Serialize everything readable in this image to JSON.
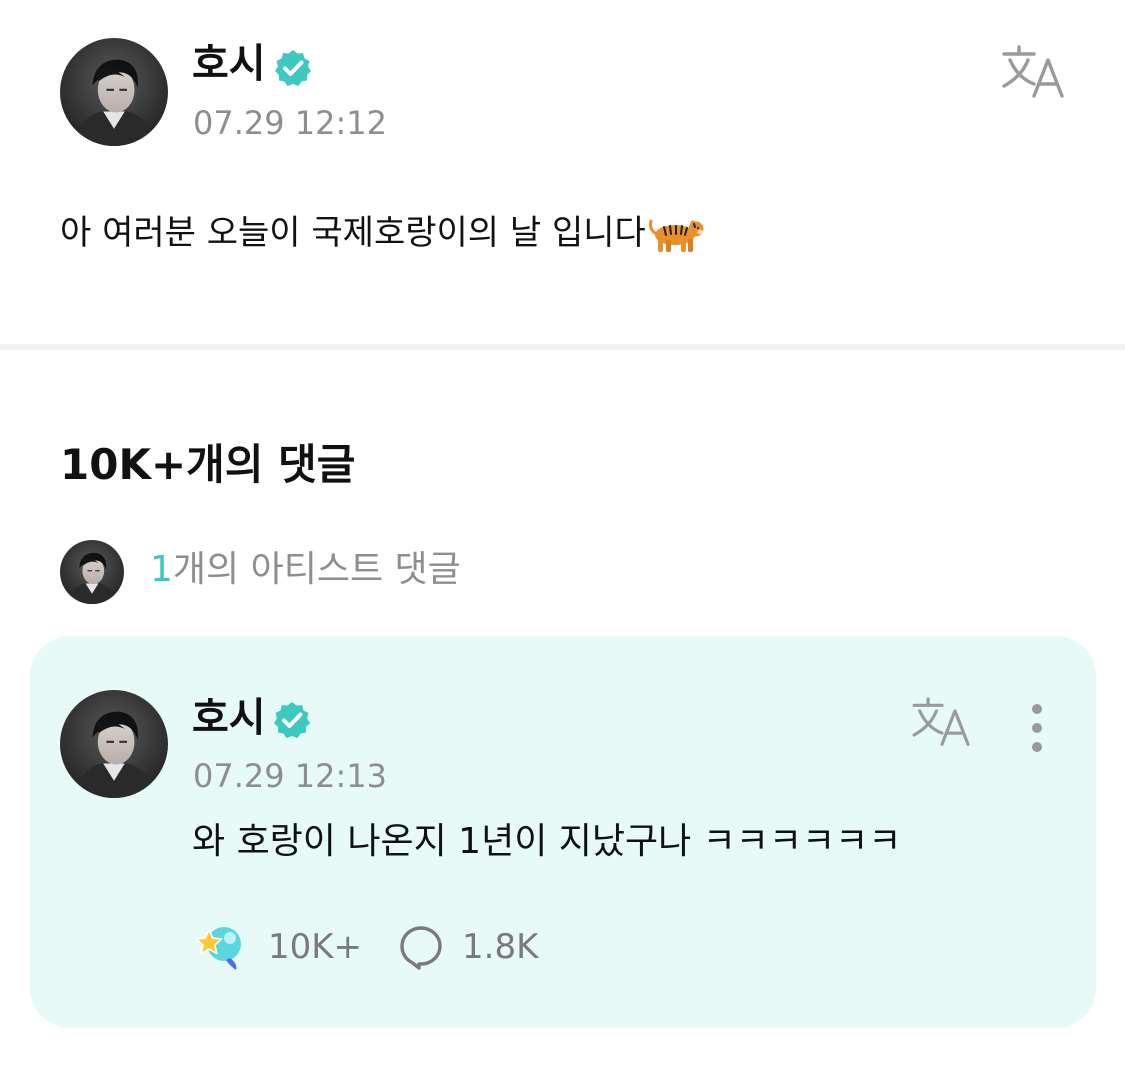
{
  "post": {
    "author": "호시",
    "timestamp": "07.29 12:12",
    "body": "아 여러분 오늘이 국제호랑이의 날 입니다",
    "body_emoji": "tiger-emoji",
    "verified_icon": "verified-badge-icon",
    "translate_icon": "translate-icon"
  },
  "comments": {
    "count_label": "10K+개의 댓글",
    "artist_row": {
      "count": "1",
      "label": "개의 아티스트 댓글"
    }
  },
  "artist_comment": {
    "author": "호시",
    "timestamp": "07.29 12:13",
    "body": "와 호랑이 나온지 1년이 지났구나 ㅋㅋㅋㅋㅋㅋ",
    "likes": "10K+",
    "replies": "1.8K",
    "like_icon": "star-like-icon",
    "reply_icon": "speech-bubble-icon",
    "more_icon": "more-vertical-icon"
  },
  "colors": {
    "accent": "#3dc8c0",
    "card_background": "#e8faf7",
    "muted_text": "#8e8e8e"
  }
}
